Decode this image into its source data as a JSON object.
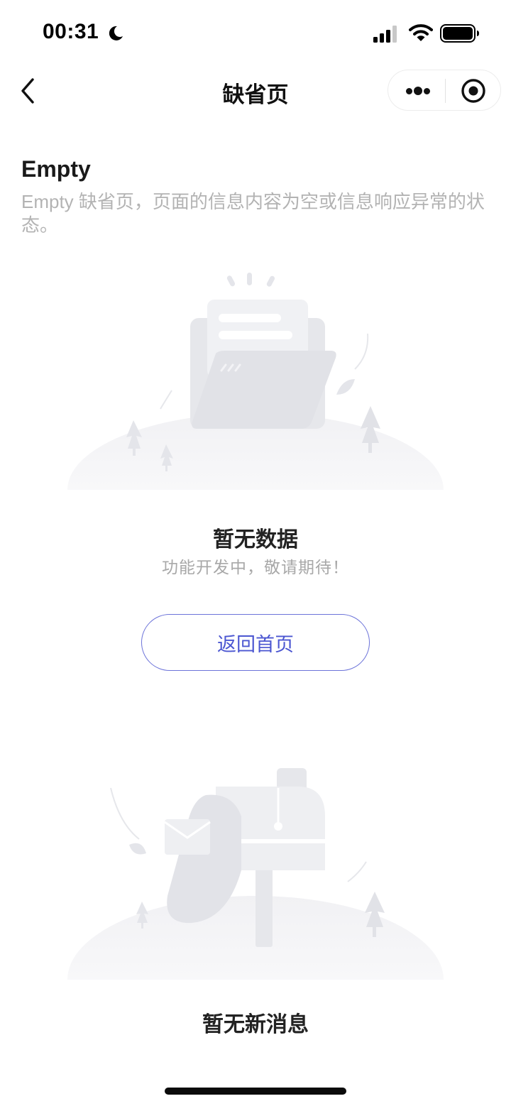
{
  "status_bar": {
    "time": "00:31"
  },
  "nav": {
    "title": "缺省页"
  },
  "header": {
    "title": "Empty",
    "description": "Empty 缺省页，页面的信息内容为空或信息响应异常的状态。"
  },
  "empty_data": {
    "title": "暂无数据",
    "subtitle": "功能开发中，敬请期待！",
    "button_label": "返回首页"
  },
  "empty_message": {
    "title": "暂无新消息"
  },
  "colors": {
    "accent": "#4b56d1",
    "illustration_light": "#eeeff3",
    "illustration_mid": "#e1e2e7",
    "illustration_dark": "#d6d7dd"
  }
}
